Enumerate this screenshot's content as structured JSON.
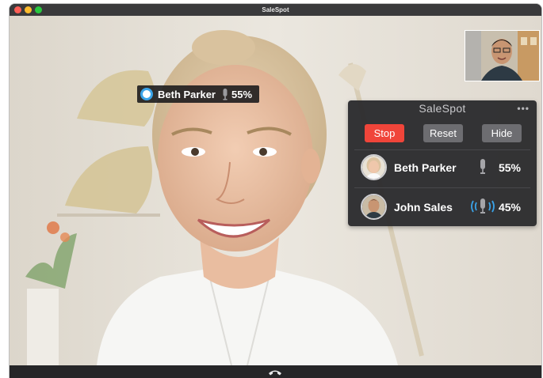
{
  "window": {
    "title": "SaleSpot"
  },
  "speaker_tag": {
    "name": "Beth Parker",
    "percent": "55%"
  },
  "panel": {
    "title": "SaleSpot",
    "menu_glyph": "•••",
    "buttons": {
      "stop": "Stop",
      "reset": "Reset",
      "hide": "Hide"
    },
    "participants": [
      {
        "name": "Beth Parker",
        "percent": "55%",
        "mic_state": "idle"
      },
      {
        "name": "John Sales",
        "percent": "45%",
        "mic_state": "speaking"
      }
    ]
  },
  "colors": {
    "accent_blue": "#3aa3e8",
    "stop_red": "#f0453a",
    "button_gray": "#6d6d71",
    "panel_bg": "#2c2c2e"
  },
  "icons": {
    "close": "close-dot",
    "minimize": "minimize-dot",
    "maximize": "maximize-dot",
    "hangup": "phone-hangup-icon",
    "mic": "microphone-icon",
    "speaking_mic": "microphone-speaking-icon"
  }
}
